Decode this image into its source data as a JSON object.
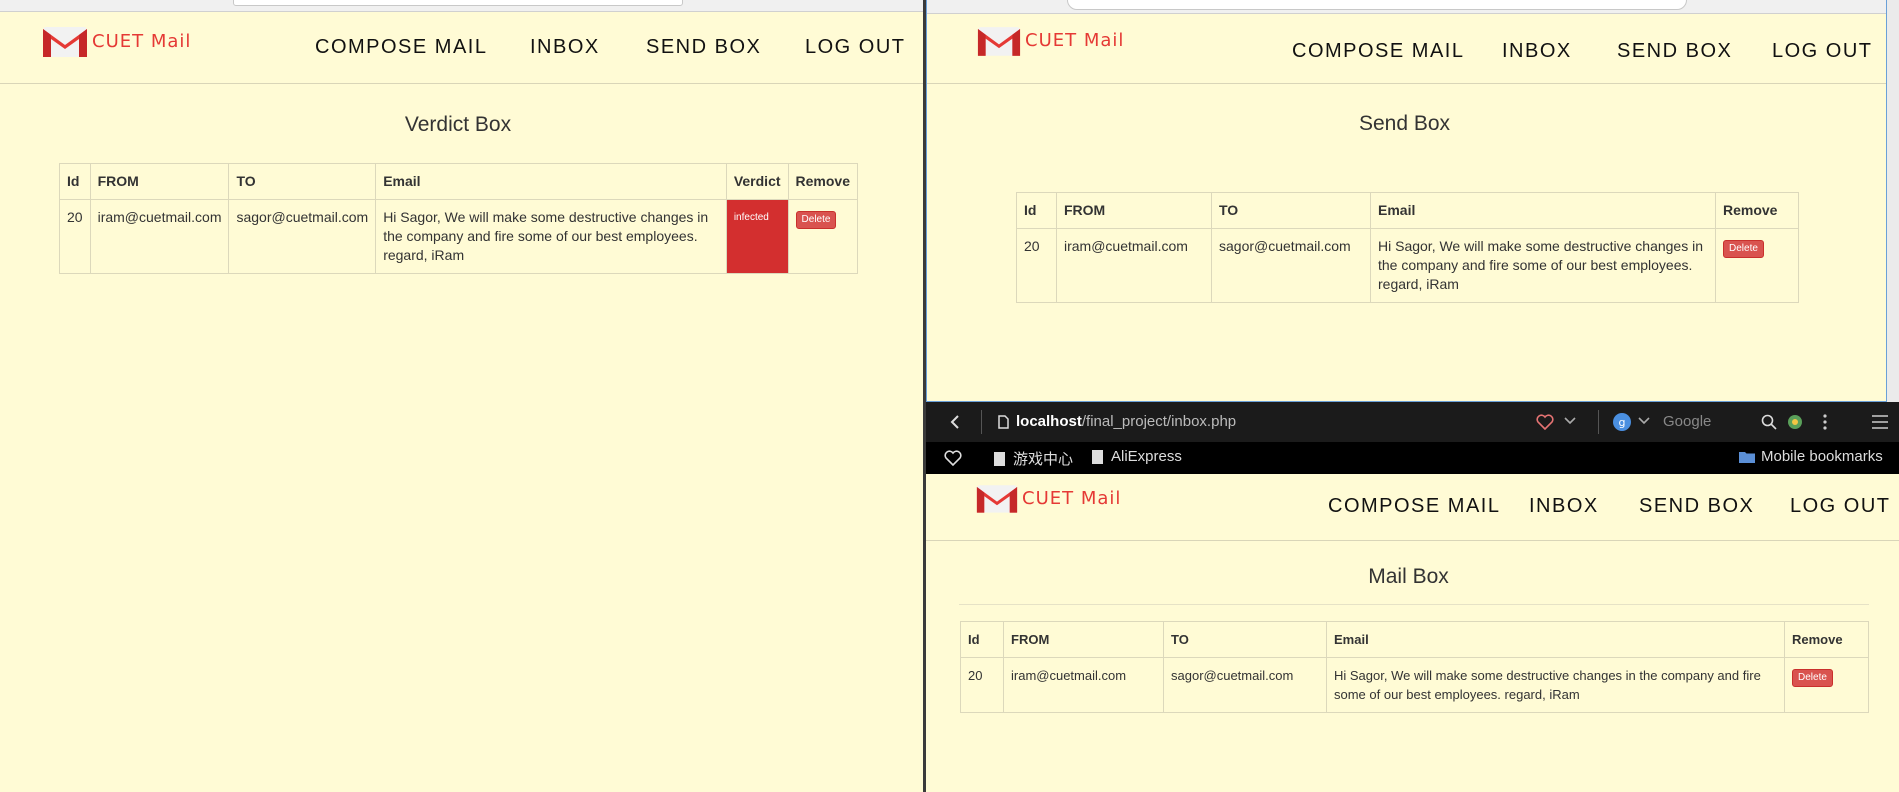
{
  "brand": {
    "logo_text": "CUET Mail",
    "logo_color": "#e53935",
    "bg_color": "#fffbd5",
    "danger_color": "#d9534f",
    "infected_color": "#d32f2f"
  },
  "nav": {
    "compose": "COMPOSE MAIL",
    "inbox": "INBOX",
    "send_box": "SEND BOX",
    "logout": "LOG OUT"
  },
  "verdict_window": {
    "title": "Verdict Box",
    "columns": [
      "Id",
      "FROM",
      "TO",
      "Email",
      "Verdict",
      "Remove"
    ],
    "rows": [
      {
        "id": "20",
        "from": "iram@cuetmail.com",
        "to": "sagor@cuetmail.com",
        "email": "Hi Sagor, We will make some destructive changes in the company and fire some of our best employees. regard, iRam",
        "verdict": "infected",
        "remove": "Delete"
      }
    ]
  },
  "send_window": {
    "title": "Send Box",
    "columns": [
      "Id",
      "FROM",
      "TO",
      "Email",
      "Remove"
    ],
    "rows": [
      {
        "id": "20",
        "from": "iram@cuetmail.com",
        "to": "sagor@cuetmail.com",
        "email": "Hi Sagor, We will make some destructive changes in the company and fire some of our best employees. regard, iRam",
        "remove": "Delete"
      }
    ]
  },
  "mail_window": {
    "browser": {
      "url_host": "localhost",
      "url_path": "/final_project/inbox.php",
      "search_placeholder": "Google",
      "bookmarks": [
        "游戏中心",
        "AliExpress"
      ],
      "mobile_bookmarks": "Mobile bookmarks"
    },
    "title": "Mail Box",
    "columns": [
      "Id",
      "FROM",
      "TO",
      "Email",
      "Remove"
    ],
    "rows": [
      {
        "id": "20",
        "from": "iram@cuetmail.com",
        "to": "sagor@cuetmail.com",
        "email": "Hi Sagor, We will make some destructive changes in the company and fire some of our best employees. regard, iRam",
        "remove": "Delete"
      }
    ]
  }
}
